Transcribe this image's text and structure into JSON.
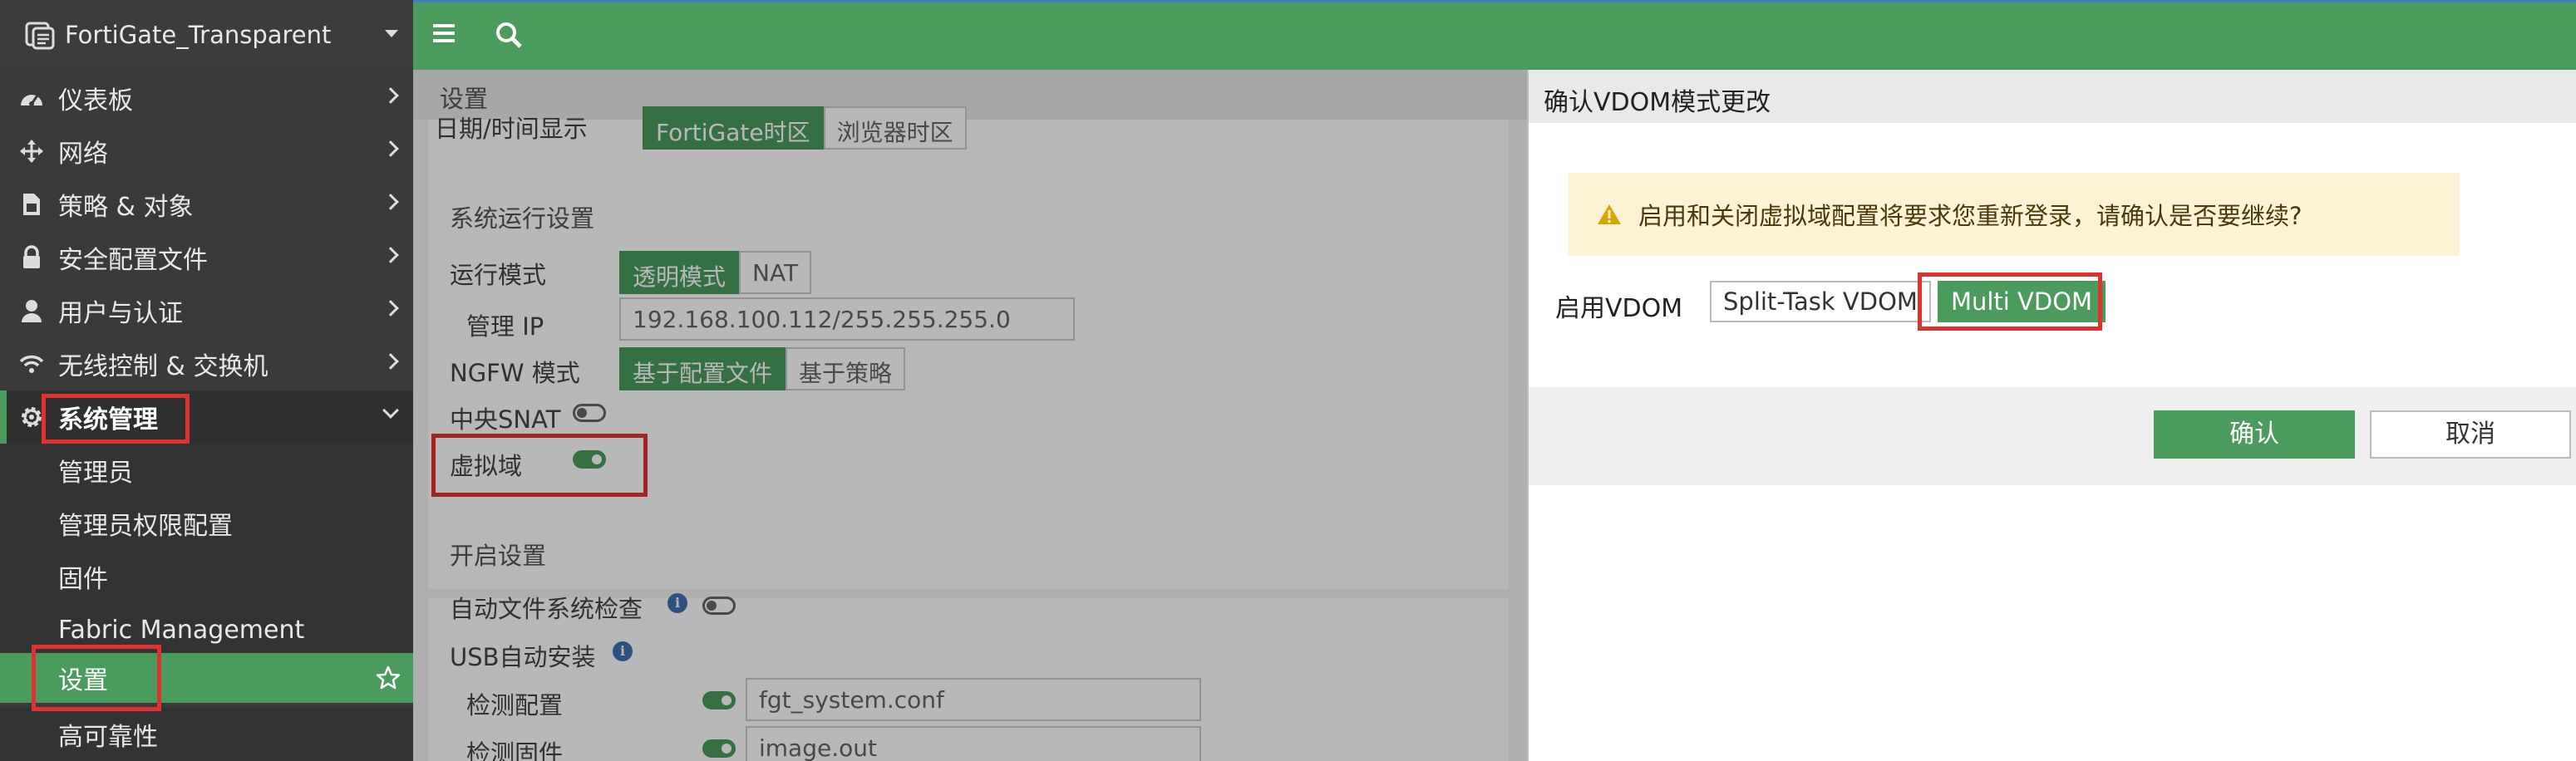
{
  "app": {
    "device_name": "FortiGate_Transparent"
  },
  "sidebar": {
    "menu": [
      {
        "label": "仪表板",
        "icon": "dashboard-icon"
      },
      {
        "label": "网络",
        "icon": "network-move-icon"
      },
      {
        "label": "策略 & 对象",
        "icon": "policy-doc-icon"
      },
      {
        "label": "安全配置文件",
        "icon": "lock-icon"
      },
      {
        "label": "用户与认证",
        "icon": "user-icon"
      },
      {
        "label": "无线控制 & 交换机",
        "icon": "wifi-icon"
      },
      {
        "label": "系统管理",
        "icon": "gear-icon"
      }
    ],
    "submenu": [
      {
        "label": "管理员"
      },
      {
        "label": "管理员权限配置"
      },
      {
        "label": "固件"
      },
      {
        "label": "Fabric Management"
      },
      {
        "label": "设置"
      },
      {
        "label": "高可靠性"
      }
    ]
  },
  "page": {
    "title": "设置",
    "datetime_label": "日期/时间显示",
    "datetime_options": [
      "FortiGate时区",
      "浏览器时区"
    ],
    "runtime_section": "系统运行设置",
    "op_mode_label": "运行模式",
    "op_mode_options": [
      "透明模式",
      "NAT"
    ],
    "mgmt_ip_label": "管理 IP",
    "mgmt_ip_value": "192.168.100.112/255.255.255.0",
    "ngfw_label": "NGFW 模式",
    "ngfw_options": [
      "基于配置文件",
      "基于策略"
    ],
    "central_snat_label": "中央SNAT",
    "vdom_label": "虚拟域",
    "startup_section": "开启设置",
    "auto_fs_check_label": "自动文件系统检查",
    "usb_install_label": "USB自动安装",
    "detect_config_label": "检测配置",
    "detect_config_value": "fgt_system.conf",
    "detect_firmware_label": "检测固件",
    "detect_firmware_value": "image.out"
  },
  "dialog": {
    "title": "确认VDOM模式更改",
    "warning": "启用和关闭虚拟域配置将要求您重新登录，请确认是否要继续?",
    "enable_label": "启用VDOM",
    "options": [
      "Split-Task VDOM",
      "Multi VDOM"
    ],
    "selected": "Multi VDOM",
    "confirm_label": "确认",
    "cancel_label": "取消"
  },
  "colors": {
    "brand_green": "#4a9b5c",
    "sidebar_bg": "#3a3a3a",
    "highlight_red": "#e03131",
    "warning_bg": "#fcf3d4"
  }
}
